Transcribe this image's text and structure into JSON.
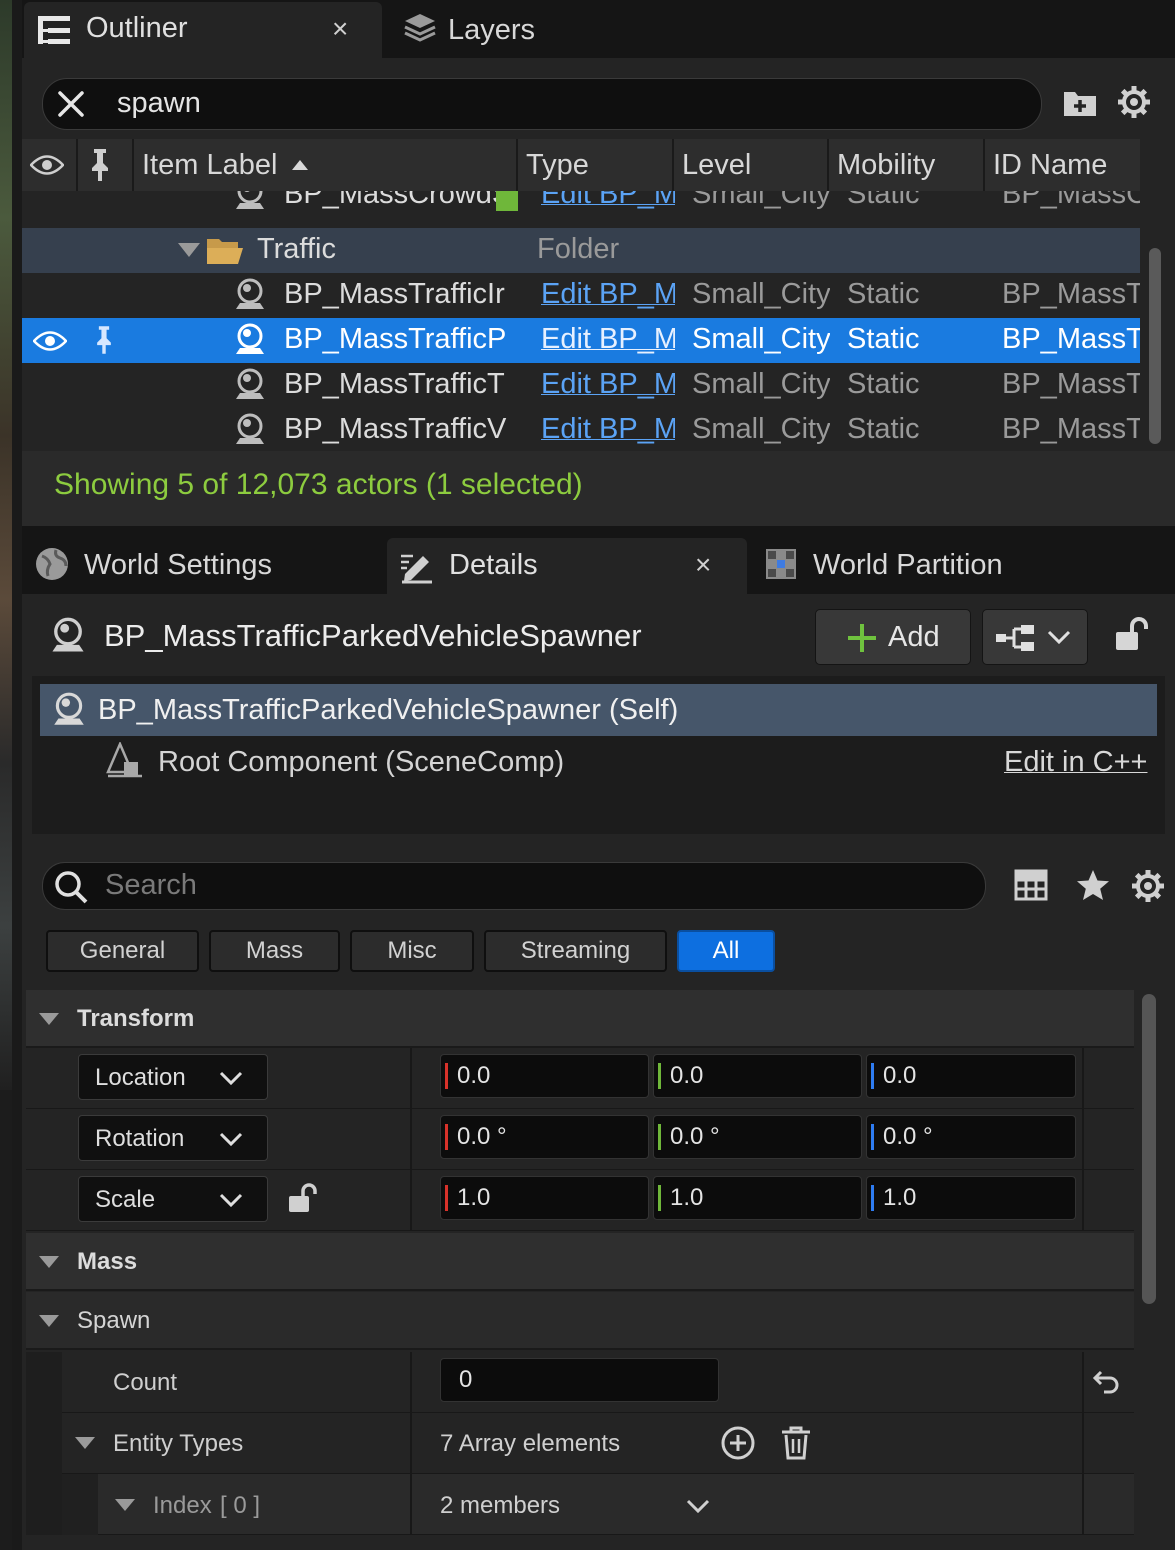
{
  "outliner_tab": {
    "label": "Outliner",
    "close": "×"
  },
  "layers_tab": {
    "label": "Layers"
  },
  "search": {
    "value": "spawn"
  },
  "columns": [
    "Item Label",
    "Type",
    "Level",
    "Mobility",
    "ID Name"
  ],
  "rows": [
    {
      "label": "BP_MassCrowdS",
      "type": "Edit BP_M",
      "level": "Small_City",
      "mobility": "Static",
      "id": "BP_MassC"
    },
    {
      "label": "Traffic",
      "type": "Folder"
    },
    {
      "label": "BP_MassTrafficIr",
      "type": "Edit BP_M",
      "level": "Small_City",
      "mobility": "Static",
      "id": "BP_MassT"
    },
    {
      "label": "BP_MassTrafficP",
      "type": "Edit BP_M",
      "level": "Small_City",
      "mobility": "Static",
      "id": "BP_MassT"
    },
    {
      "label": "BP_MassTrafficT",
      "type": "Edit BP_M",
      "level": "Small_City",
      "mobility": "Static",
      "id": "BP_MassT"
    },
    {
      "label": "BP_MassTrafficV",
      "type": "Edit BP_M",
      "level": "Small_City",
      "mobility": "Static",
      "id": "BP_MassT"
    }
  ],
  "status": "Showing 5 of 12,073 actors (1 selected)",
  "details_tabs": {
    "world_settings": "World Settings",
    "details": "Details",
    "close": "×",
    "world_partition": "World Partition"
  },
  "actor": {
    "name": "BP_MassTrafficParkedVehicleSpawner",
    "add_label": "Add"
  },
  "components": {
    "self": "BP_MassTrafficParkedVehicleSpawner (Self)",
    "root": "Root Component (SceneComp)",
    "edit_cpp": "Edit in C++"
  },
  "details_search": {
    "placeholder": "Search"
  },
  "filters": [
    "General",
    "Mass",
    "Misc",
    "Streaming",
    "All"
  ],
  "active_filter": "All",
  "transform": {
    "title": "Transform",
    "location": {
      "label": "Location",
      "x": "0.0",
      "y": "0.0",
      "z": "0.0"
    },
    "rotation": {
      "label": "Rotation",
      "x": "0.0 °",
      "y": "0.0 °",
      "z": "0.0 °"
    },
    "scale": {
      "label": "Scale",
      "x": "1.0",
      "y": "1.0",
      "z": "1.0"
    }
  },
  "mass": {
    "title": "Mass",
    "spawn_title": "Spawn",
    "count_label": "Count",
    "count_value": "0",
    "entity_types_label": "Entity Types",
    "entity_types_value": "7 Array elements",
    "index_label": "Index",
    "index_value": "[ 0 ]",
    "index_members": "2 members"
  },
  "colors": {
    "accent": "#1a7be0",
    "status": "#8dcc3f",
    "link": "#5ba3f5",
    "x_axis": "#d8322a",
    "y_axis": "#6fb73a",
    "z_axis": "#2e7cf2"
  }
}
